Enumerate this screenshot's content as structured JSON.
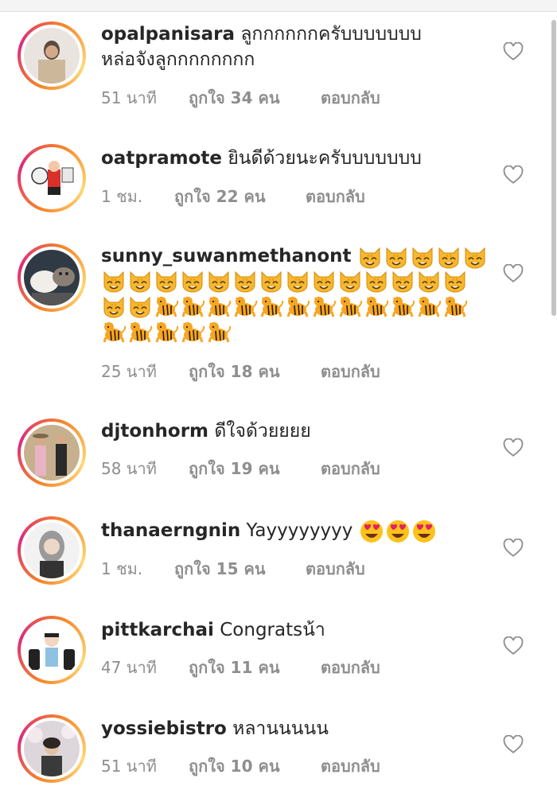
{
  "comments": [
    {
      "username": "opalpanisara",
      "text": "ลูกกกกกกครับบบบบบบ",
      "text2": "หล่อจังลูกกกกกกกก",
      "time": "51 นาที",
      "likes": "ถูกใจ 34 คน",
      "reply": "ตอบกลับ"
    },
    {
      "username": "oatpramote",
      "text": "ยินดีด้วยนะครับบบบบบบ",
      "time": "1 ชม.",
      "likes": "ถูกใจ 22 คน",
      "reply": "ตอบกลับ"
    },
    {
      "username": "sunny_suwanmethanont",
      "text": "",
      "emoji_rows": [
        "5 smiling cats",
        "14 smiling cats",
        "2 smiling cats + 12 tiger",
        "5 tiger"
      ],
      "time": "25 นาที",
      "likes": "ถูกใจ 18 คน",
      "reply": "ตอบกลับ"
    },
    {
      "username": "djtonhorm",
      "text": "ดีใจด้วยยยย",
      "time": "58 นาที",
      "likes": "ถูกใจ 19 คน",
      "reply": "ตอบกลับ"
    },
    {
      "username": "thanaerngnin",
      "text": "Yayyyyyyyy",
      "time": "1 ชม.",
      "likes": "ถูกใจ 15 คน",
      "reply": "ตอบกลับ"
    },
    {
      "username": "pittkarchai",
      "text": "Congratsน้า",
      "time": "47 นาที",
      "likes": "ถูกใจ 11 คน",
      "reply": "ตอบกลับ"
    },
    {
      "username": "yossiebistro",
      "text": "หลานนนนน",
      "time": "51 นาที",
      "likes": "ถูกใจ 10 คน",
      "reply": "ตอบกลับ"
    }
  ],
  "icons": {
    "like": "heart-outline-icon",
    "cat": "smiling-cat-emoji",
    "tiger": "tiger-emoji",
    "heart_eyes": "heart-eyes-emoji"
  },
  "colors": {
    "ring_orange": "#f58529",
    "ring_pink": "#dd2a7b",
    "meta_gray": "#8e8e8e"
  }
}
